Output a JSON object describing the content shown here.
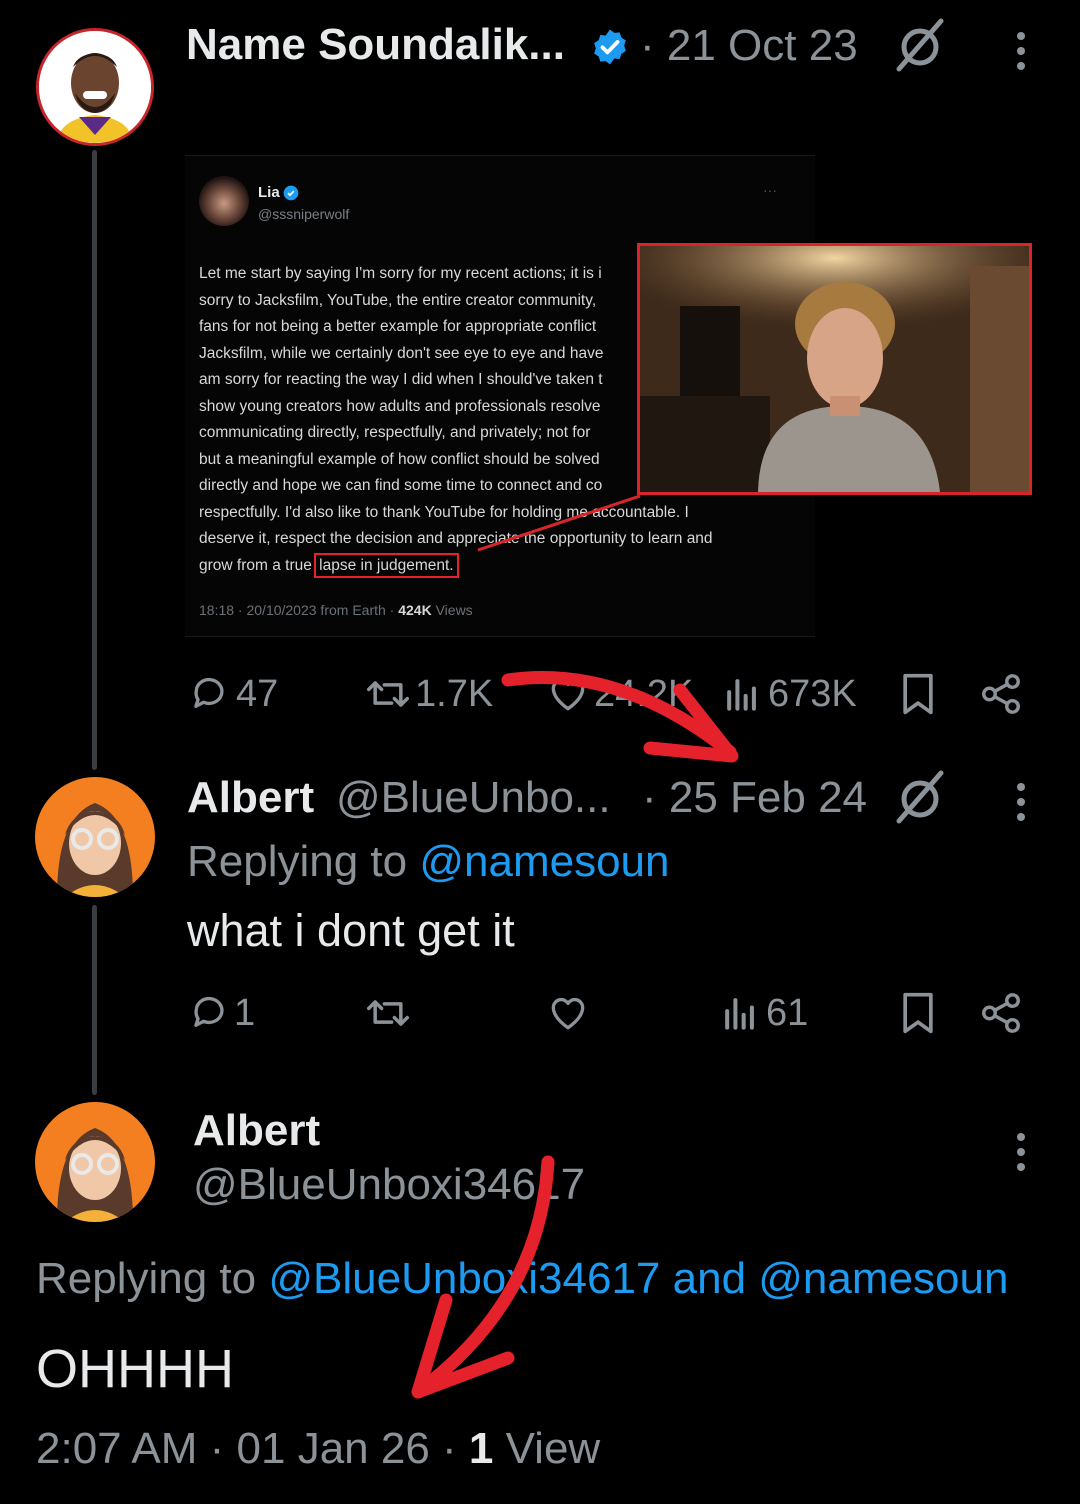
{
  "tweet1": {
    "name": "Name Soundalik...",
    "date": "· 21 Oct 23",
    "embed": {
      "name": "Lia",
      "handle": "@sssniperwolf",
      "lines": [
        "Let me start by saying I'm sorry for my recent actions; it is i",
        "sorry to Jacksfilm, YouTube, the entire creator community,",
        "fans for not being a better example for appropriate conflict",
        "Jacksfilm, while we certainly don't see eye to eye and have",
        "am sorry for reacting the way I did when I should've taken t",
        "show young creators how adults and professionals resolve",
        "communicating directly, respectfully, and privately; not for",
        "but a meaningful example of how conflict should be solved",
        "directly and hope we can find some time to connect and co",
        "respectfully. I'd also like to thank YouTube for holding me accountable. I",
        "deserve it, respect the decision and appreciate the opportunity to learn and"
      ],
      "last_line_prefix": "grow from a true ",
      "highlight": "lapse in judgement.",
      "footer_time": "18:18 · 20/10/2023 from Earth · ",
      "footer_views_num": "424K",
      "footer_views_label": " Views"
    },
    "actions": {
      "replies": "47",
      "retweets": "1.7K",
      "likes": "24.2K",
      "views": "673K"
    }
  },
  "tweet2": {
    "name": "Albert",
    "handle": "@BlueUnbo...",
    "date": "· 25 Feb 24",
    "replying_label": "Replying to ",
    "replying_to": "@namesoun",
    "text": "what i dont get it",
    "actions": {
      "replies": "1",
      "views": "61"
    }
  },
  "tweet3": {
    "name": "Albert",
    "handle": "@BlueUnboxi34617",
    "replying_label": "Replying to ",
    "replying_to": "@BlueUnboxi34617 and @namesoun",
    "text": "OHHHH",
    "time": "2:07 AM · 01 Jan 26 · ",
    "views_num": "1",
    "views_label": " View"
  },
  "colors": {
    "accent": "#1d9bf0",
    "annotation_red": "#e5222b",
    "muted": "#8b9399"
  },
  "icons": [
    "verified-icon",
    "grok-icon",
    "more-icon",
    "reply-icon",
    "retweet-icon",
    "like-icon",
    "views-icon",
    "bookmark-icon",
    "share-icon"
  ]
}
